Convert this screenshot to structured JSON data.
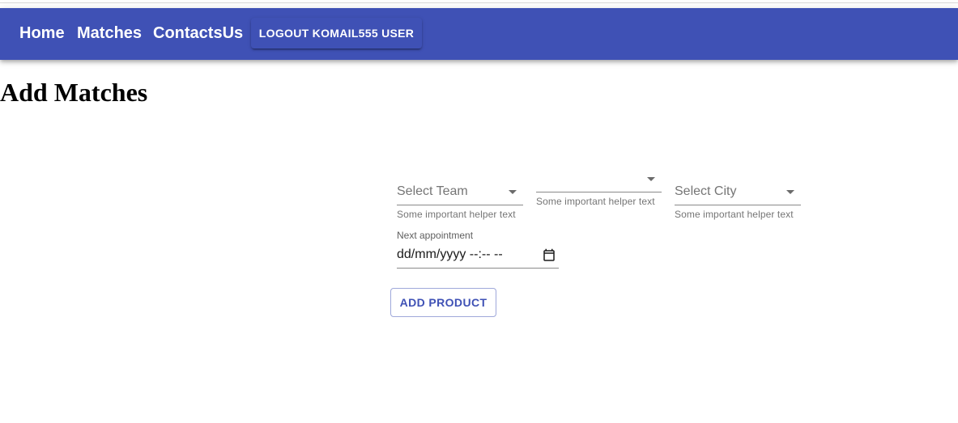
{
  "nav": {
    "home": "Home",
    "matches": "Matches",
    "contacts": "ContactsUs",
    "logout": "LOGOUT KOMAIL555 USER"
  },
  "page": {
    "title": "Add Matches"
  },
  "form": {
    "team_select": {
      "placeholder": "Select Team",
      "helper": "Some important helper text"
    },
    "second_select": {
      "placeholder": "",
      "helper": "Some important helper text"
    },
    "city_select": {
      "placeholder": "Select City",
      "helper": "Some important helper text"
    },
    "appointment": {
      "label": "Next appointment",
      "value": "dd/mm/yyyy --:-- --",
      "icon": "calendar-icon"
    },
    "submit_label": "ADD PRODUCT"
  },
  "colors": {
    "primary": "#3f51b5",
    "helper_text": "#757575"
  }
}
